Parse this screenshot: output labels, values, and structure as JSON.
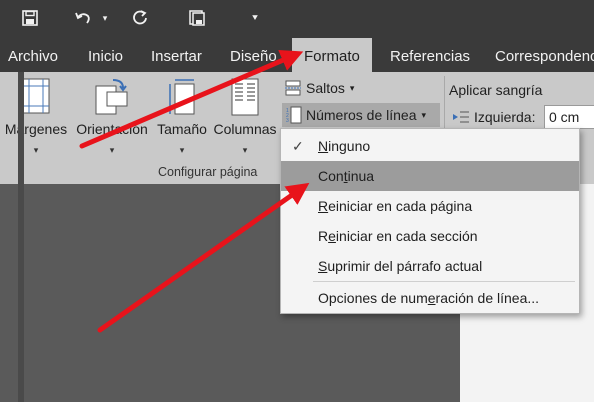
{
  "tabs": [
    "Archivo",
    "Inicio",
    "Insertar",
    "Diseño",
    "Formato",
    "Referencias",
    "Correspondencia"
  ],
  "ribbon": {
    "margenes": "Márgenes",
    "orientacion": "Orientación",
    "tamano": "Tamaño",
    "columnas": "Columnas",
    "group_label": "Configurar página",
    "saltos": "Saltos",
    "numeros_linea": "Números de línea",
    "aplicar_sangria": "Aplicar sangría",
    "izquierda": "Izquierda:",
    "izquierda_value": "0 cm"
  },
  "menu": {
    "items": [
      {
        "pre": "",
        "acc": "N",
        "post": "inguno",
        "checked": true
      },
      {
        "pre": "Con",
        "acc": "t",
        "post": "inua",
        "checked": false
      },
      {
        "pre": "",
        "acc": "R",
        "post": "einiciar en cada página",
        "checked": false
      },
      {
        "pre": "R",
        "acc": "e",
        "post": "iniciar en cada sección",
        "checked": false
      },
      {
        "pre": "",
        "acc": "S",
        "post": "uprimir del párrafo actual",
        "checked": false
      },
      {
        "pre": "Opciones de num",
        "acc": "e",
        "post": "ración de línea...",
        "checked": false
      }
    ]
  },
  "colors": {
    "ribbon": "#c9c9c9",
    "titlebar": "#3a3a3a",
    "highlight": "#9c9c9c",
    "arrow": "#e8131b"
  }
}
